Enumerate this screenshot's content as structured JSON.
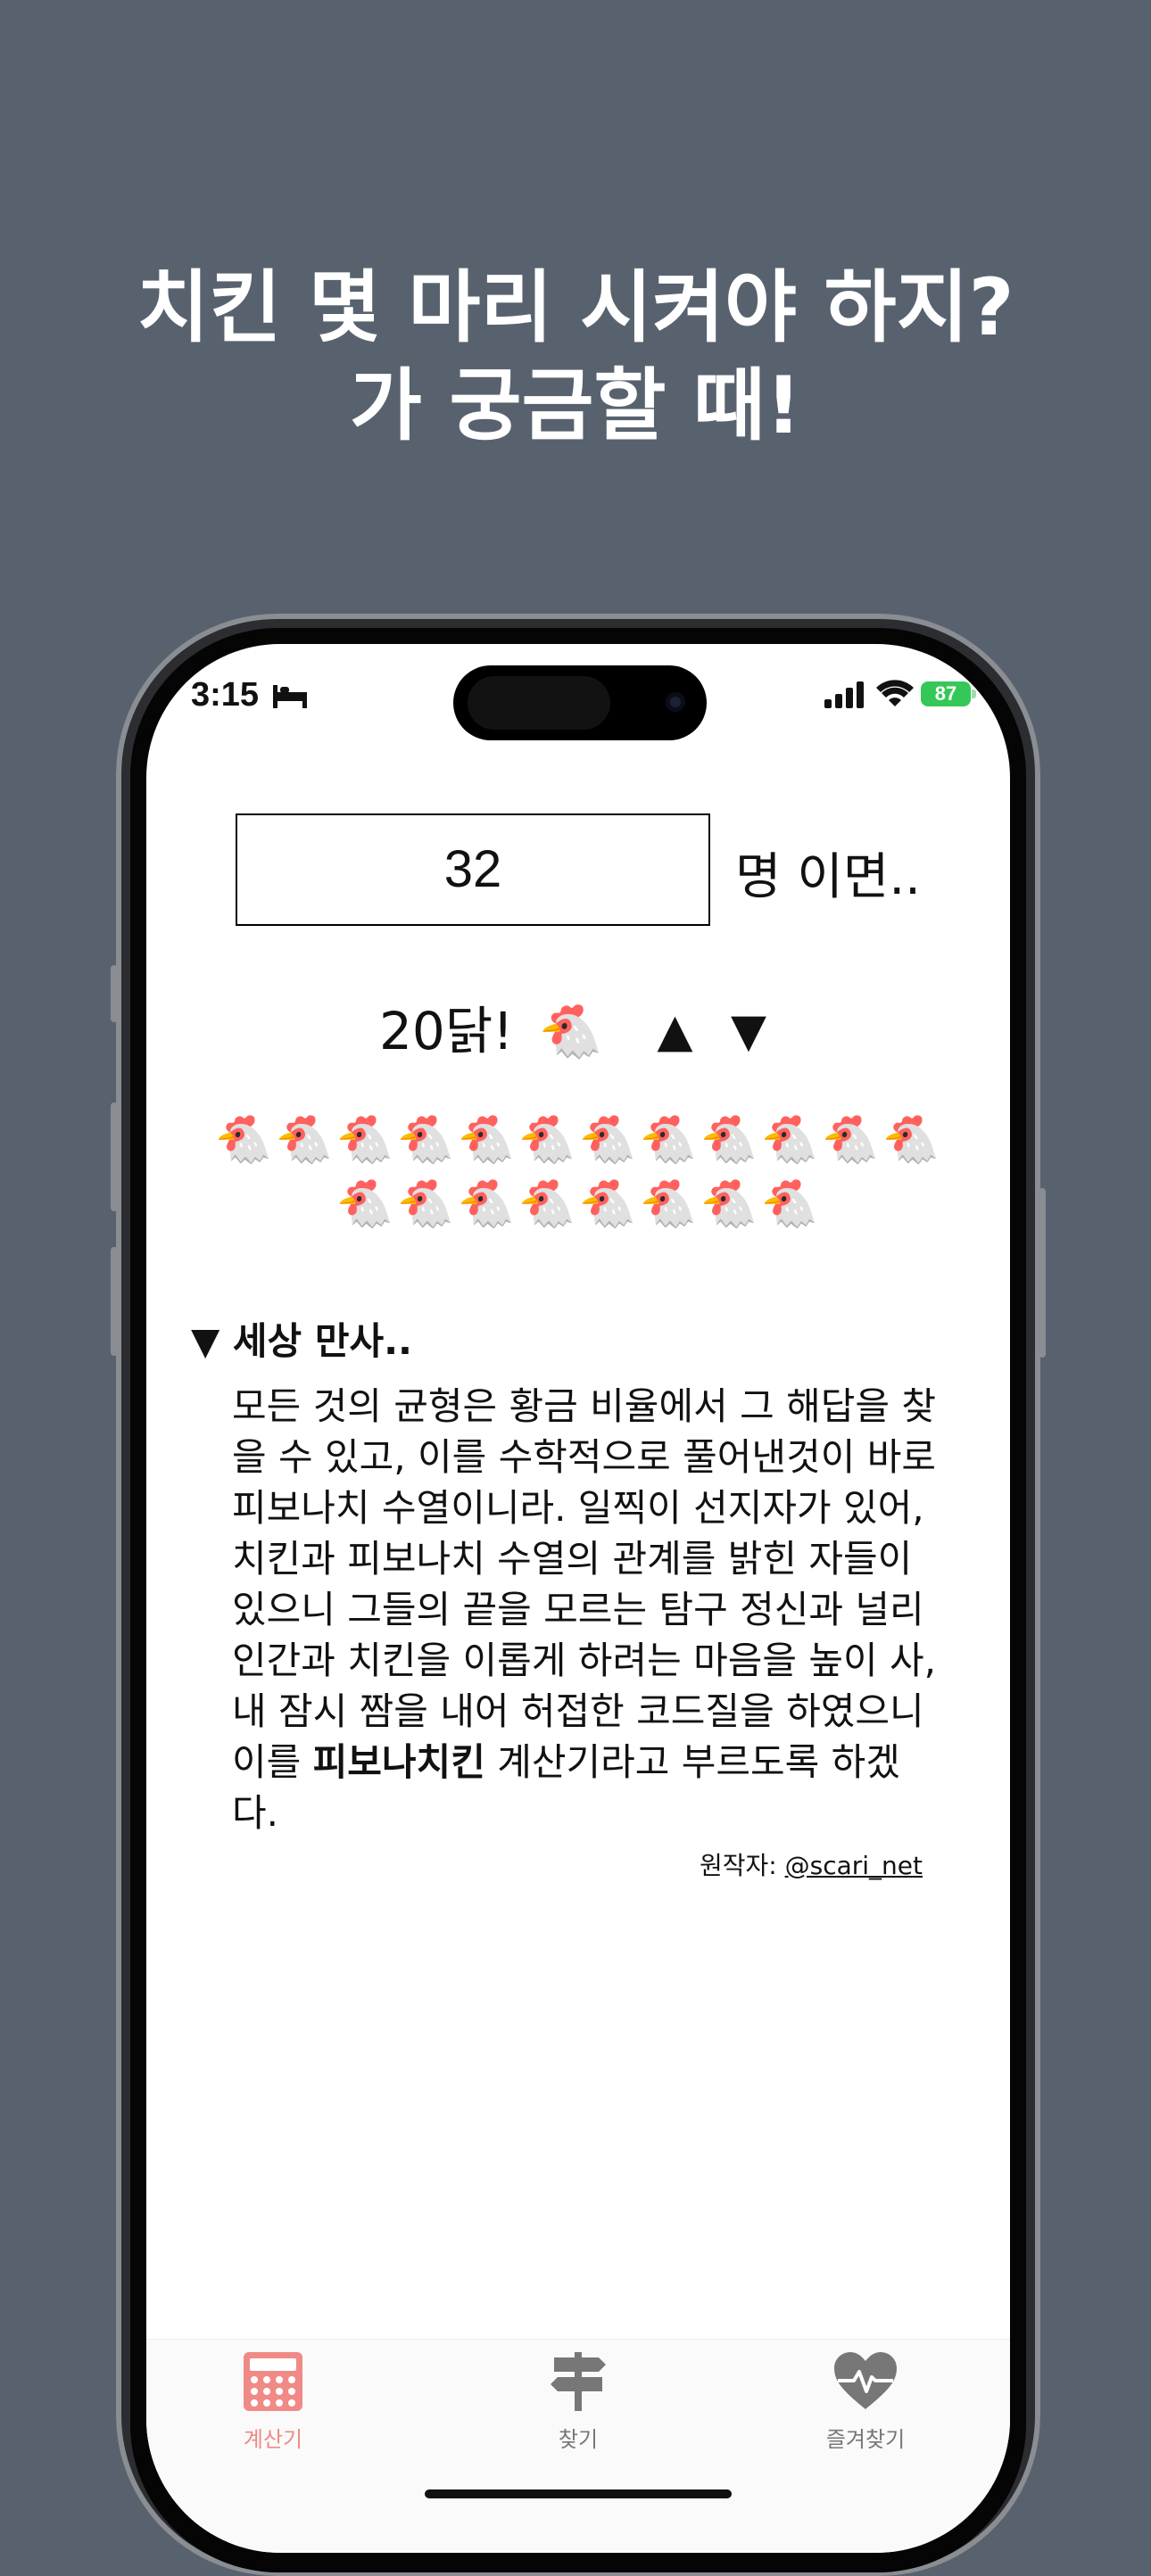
{
  "headline": {
    "line1": "치킨 몇 마리 시켜야 하지?",
    "line2": "가 궁금할 때!"
  },
  "status_bar": {
    "time": "3:15",
    "battery": "87"
  },
  "calculator": {
    "people_count": "32",
    "people_suffix": "명 이면..",
    "result_text": "20닭!",
    "result_emoji": "🐔",
    "increase_symbol": "▲",
    "decrease_symbol": "▼",
    "chicken_count": 20,
    "chicken_emoji": "🐔"
  },
  "about": {
    "summary": "▼ 세상 만사..",
    "paragraph_before_bold": "모든 것의 균형은 황금 비율에서 그 해답을 찾을 수 있고, 이를 수학적으로 풀어낸것이 바로 피보나치 수열이니라. 일찍이 선지자가 있어, 치킨과 피보나치 수열의 관계를 밝힌 자들이 있으니 그들의 끝을 모르는 탐구 정신과 널리 인간과 치킨을 이롭게 하려는 마음을 높이 사, 내 잠시 짬을 내어 허접한 코드질을 하였으니 이를 ",
    "bold_text": "피보나치킨",
    "paragraph_after_bold": " 계산기라고 부르도록 하겠다.",
    "credit_label": "원작자:",
    "credit_link": "@scari_net"
  },
  "tabbar": {
    "tabs": [
      {
        "label": "계산기",
        "icon": "calculator-icon",
        "active": true
      },
      {
        "label": "찾기",
        "icon": "signpost-icon",
        "active": false
      },
      {
        "label": "즐겨찾기",
        "icon": "heart-pulse-icon",
        "active": false
      }
    ]
  },
  "colors": {
    "background": "#58626f",
    "active_tab": "#f08a86",
    "inactive_tab": "#777777",
    "battery": "#36c759"
  }
}
